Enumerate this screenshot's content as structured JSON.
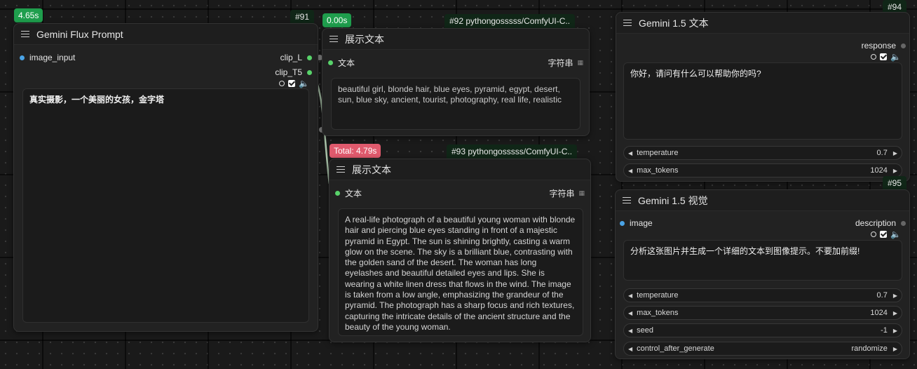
{
  "timers": {
    "node91": "4.65s",
    "node92": "0.00s",
    "total": "Total: 4.79s"
  },
  "node91": {
    "id": "#91",
    "title": "Gemini Flux Prompt",
    "input": "image_input",
    "outputs": [
      "clip_L",
      "clip_T5"
    ],
    "text": "真实摄影，一个美丽的女孩，金字塔"
  },
  "node92": {
    "id": "#92 pythongosssss/ComfyUI-C..",
    "title": "展示文本",
    "input": "文本",
    "output": "字符串",
    "text": "beautiful girl, blonde hair, blue eyes, pyramid, egypt, desert, sun, blue sky, ancient, tourist, photography, real life, realistic"
  },
  "node93": {
    "id": "#93 pythongosssss/ComfyUI-C..",
    "title": "展示文本",
    "input": "文本",
    "output": "字符串",
    "text": "A real-life photograph of a beautiful young woman with blonde hair and piercing blue eyes standing in front of a majestic pyramid in Egypt. The sun is shining brightly, casting a warm glow on the scene. The sky is a brilliant blue, contrasting with the golden sand of the desert. The woman has long eyelashes and beautiful detailed eyes and lips. She is wearing a white linen dress that flows in the wind. The image is taken from a low angle, emphasizing the grandeur of the pyramid. The photograph has a sharp focus and rich textures, capturing the intricate details of the ancient structure and the beauty of the young woman."
  },
  "node94": {
    "id": "#94",
    "title": "Gemini 1.5 文本",
    "output": "response",
    "text": "你好，请问有什么可以帮助你的吗?",
    "widgets": [
      {
        "label": "temperature",
        "value": "0.7"
      },
      {
        "label": "max_tokens",
        "value": "1024"
      }
    ]
  },
  "node95": {
    "id": "#95",
    "title": "Gemini 1.5 视觉",
    "input": "image",
    "output": "description",
    "text": "分析这张图片并生成一个详细的文本到图像提示。不要加前缀!",
    "widgets": [
      {
        "label": "temperature",
        "value": "0.7"
      },
      {
        "label": "max_tokens",
        "value": "1024"
      },
      {
        "label": "seed",
        "value": "-1"
      },
      {
        "label": "control_after_generate",
        "value": "randomize"
      }
    ]
  },
  "colors": {
    "badge_green": "#1f9e4d",
    "badge_red": "#e05a6d",
    "slot_green": "#58d36a",
    "slot_blue": "#4aa3e6"
  }
}
